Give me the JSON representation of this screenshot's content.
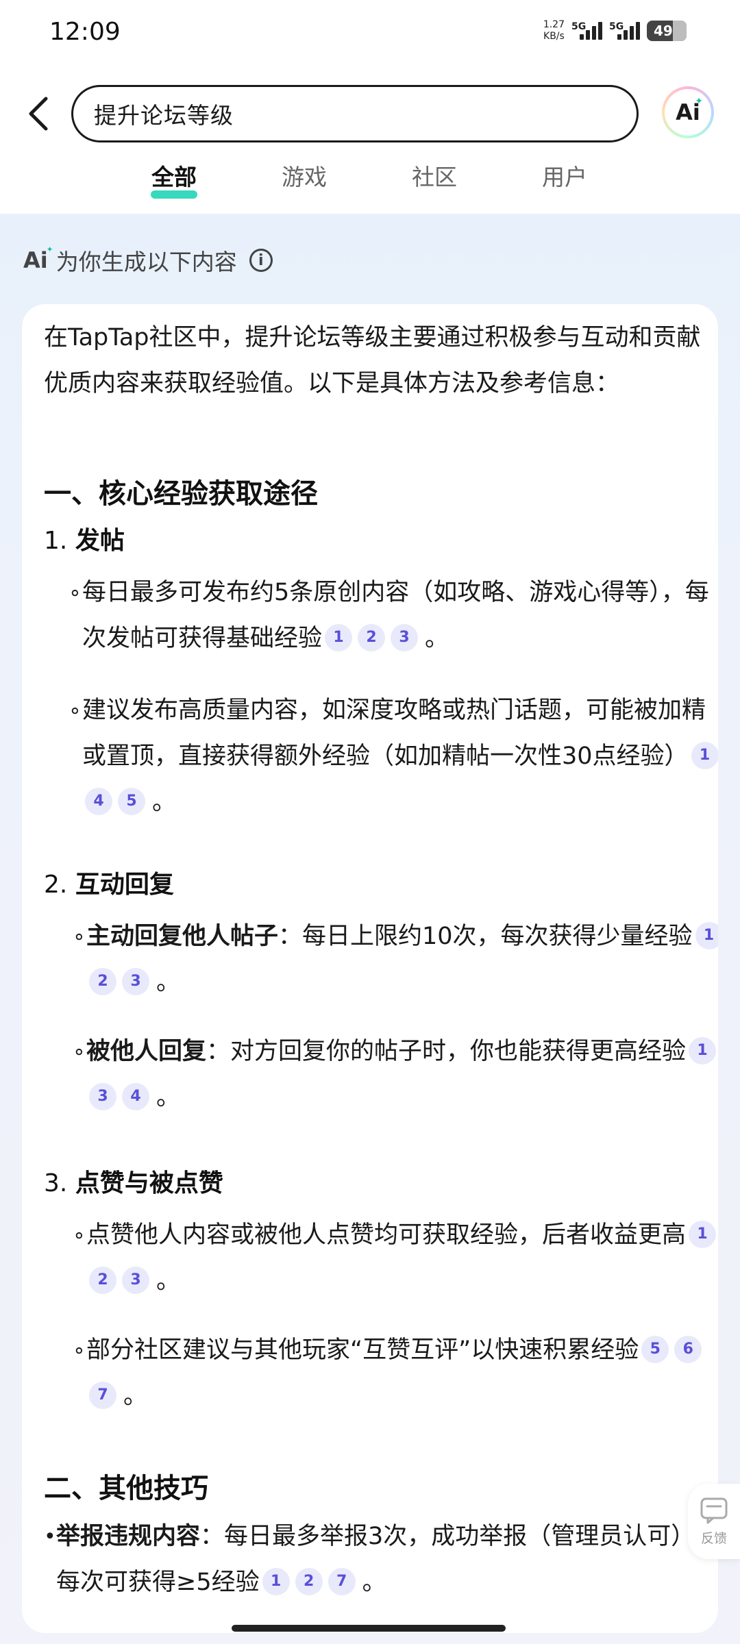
{
  "status_bar": {
    "time": "12:09",
    "net_speed_value": "1.27",
    "net_speed_unit": "KB/s",
    "signal1": "5G",
    "signal2": "5G",
    "battery": "49"
  },
  "header": {
    "search_text": "提升论坛等级",
    "ai_button": "Ai"
  },
  "tabs": [
    {
      "label": "全部",
      "active": true
    },
    {
      "label": "游戏",
      "active": false
    },
    {
      "label": "社区",
      "active": false
    },
    {
      "label": "用户",
      "active": false
    }
  ],
  "ai_section": {
    "mini": "Ai",
    "label": "为你生成以下内容"
  },
  "content": {
    "intro": "在TapTap社区中，提升论坛等级主要通过积极参与互动和贡献优质内容来获取经验值。以下是具体方法及参考信息：",
    "h_core": "一、核心经验获取途径",
    "s1_num": "1.",
    "s1_title": "发帖",
    "s1_b1": "每日最多可发布约5条原创内容（如攻略、游戏心得等），每次发帖可获得基础经验",
    "s1_b1_cites": [
      "1",
      "2",
      "3"
    ],
    "s1_b2": "建议发布高质量内容，如深度攻略或热门话题，可能被加精或置顶，直接获得额外经验（如加精帖一次性30点经验）",
    "s1_b2_cites": [
      "1",
      "4",
      "5"
    ],
    "s2_num": "2.",
    "s2_title": "互动回复",
    "s2_b1_bold": "主动回复他人帖子",
    "s2_b1": "：每日上限约10次，每次获得少量经验",
    "s2_b1_cites": [
      "1",
      "2",
      "3"
    ],
    "s2_b2_bold": "被他人回复",
    "s2_b2": "：对方回复你的帖子时，你也能获得更高经验",
    "s2_b2_cites": [
      "1",
      "3",
      "4"
    ],
    "s3_num": "3.",
    "s3_title": "点赞与被点赞",
    "s3_b1": "点赞他人内容或被他人点赞均可获取经验，后者收益更高",
    "s3_b1_cites": [
      "1",
      "2",
      "3"
    ],
    "s3_b2": "部分社区建议与其他玩家“互赞互评”以快速积累经验",
    "s3_b2_cites": [
      "5",
      "6",
      "7"
    ],
    "h_other": "二、其他技巧",
    "o_b1_bold": "举报违规内容",
    "o_b1": "：每日最多举报3次，成功举报（管理员认可）每次可获得≥5经验",
    "o_b1_cites": [
      "1",
      "2",
      "7"
    ],
    "period": "。"
  },
  "feedback": {
    "label": "反馈"
  }
}
